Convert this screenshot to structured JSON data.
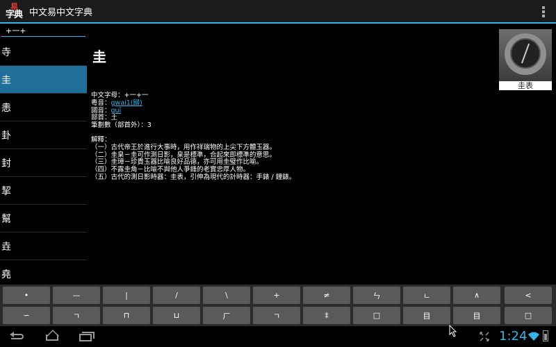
{
  "app": {
    "icon_top": "易",
    "icon_bottom": "字典",
    "title": "中文易中文字典"
  },
  "search": {
    "value": "+一+"
  },
  "list": {
    "selected_index": 1,
    "items": [
      "寺",
      "圭",
      "恚",
      "卦",
      "封",
      "挈",
      "幫",
      "垚",
      "堯"
    ]
  },
  "entry": {
    "headword": "圭",
    "lines": [
      {
        "label": "中文字母：",
        "value": "+一+一"
      },
      {
        "label": "粵音：",
        "link": "gwai1(歸)"
      },
      {
        "label": "國音：",
        "link": "guī"
      },
      {
        "label": "部首：",
        "value": "土"
      },
      {
        "label": "筆劃數（部首外）：",
        "value": "3"
      }
    ],
    "definition_title": "解釋：",
    "definitions": [
      "（一）古代帝王於進行大事時，用作祥瑞物的上尖下方體玉器。",
      "（二）圭臬－圭可作測日影，臬是標準，合起來即標準的意思。",
      "（三）圭璋－珍貴玉器比喻良好品德，亦可用圭璧作比喻。",
      "（四）不露圭角－比喻不與他人爭鋒的老實忠厚人物。",
      "（五）古代的測日影時器：圭表，引伸為現代的計時器：手錶 / 鐘錶。"
    ]
  },
  "thumbnail": {
    "caption": "圭表"
  },
  "keyboard": {
    "row1": [
      "•",
      "—",
      "|",
      "/",
      "\\",
      "+",
      "≠",
      "ㄣ",
      "ㄴ",
      "∧",
      "<"
    ],
    "row2": [
      "∽",
      "ㄱ",
      "⊓",
      "⊔",
      "ㄏ",
      "ㄱ",
      "‡",
      "□",
      "目",
      "目",
      "□"
    ]
  },
  "status": {
    "time": "1:24"
  }
}
